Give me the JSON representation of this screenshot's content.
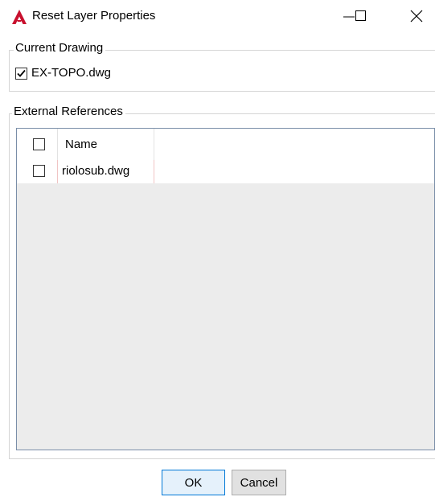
{
  "window": {
    "title": "Reset Layer Properties",
    "app_icon": "autocad-a-icon",
    "controls": [
      "minimize-icon",
      "maximize-icon",
      "close-icon"
    ]
  },
  "current_drawing": {
    "legend": "Current Drawing",
    "item": {
      "label": "EX-TOPO.dwg",
      "checked": true
    }
  },
  "external_references": {
    "legend": "External References",
    "columns": [
      "Name"
    ],
    "select_all_checked": false,
    "rows": [
      {
        "name": "riolosub.dwg",
        "checked": false
      }
    ]
  },
  "buttons": {
    "ok": "OK",
    "cancel": "Cancel"
  },
  "colors": {
    "accent": "#0078d7",
    "grid_empty": "#ececec",
    "app_icon": "#c8102e"
  }
}
